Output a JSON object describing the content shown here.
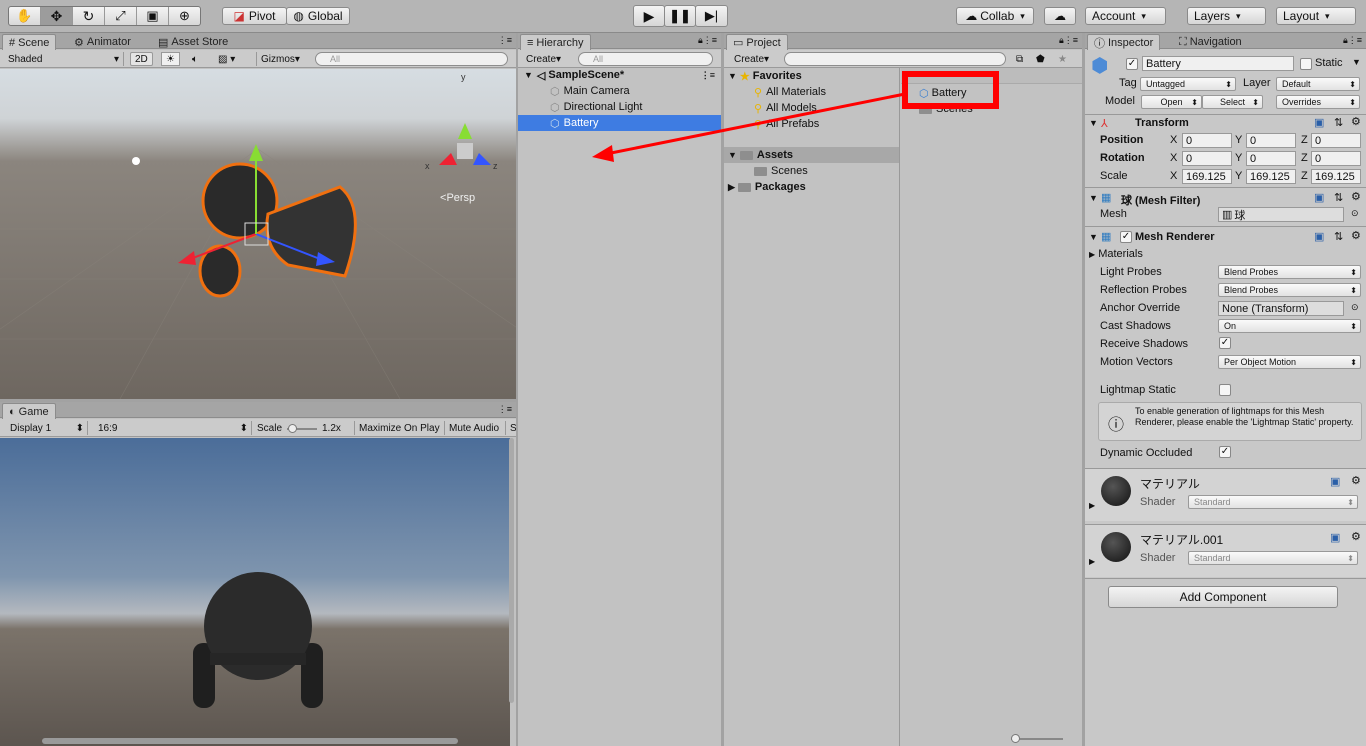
{
  "top": {
    "pivot": "Pivot",
    "global": "Global",
    "collab": "Collab",
    "account": "Account",
    "layers": "Layers",
    "layout": "Layout"
  },
  "scene": {
    "tabs": [
      "Scene",
      "Animator",
      "Asset Store"
    ],
    "shading": "Shaded",
    "mode2d": "2D",
    "gizmos": "Gizmos",
    "search_placeholder": "All",
    "persp": "Persp",
    "axis": {
      "x": "x",
      "y": "y",
      "z": "z"
    }
  },
  "game": {
    "tab": "Game",
    "display": "Display 1",
    "aspect": "16:9",
    "scale_label": "Scale",
    "scale_value": "1.2x",
    "maximize": "Maximize On Play",
    "mute": "Mute Audio",
    "stats": "S"
  },
  "hierarchy": {
    "tab": "Hierarchy",
    "create": "Create",
    "search_placeholder": "All",
    "scene": "SampleScene*",
    "items": [
      "Main Camera",
      "Directional Light",
      "Battery"
    ]
  },
  "project": {
    "tab": "Project",
    "create": "Create",
    "favorites": "Favorites",
    "fav_items": [
      "All Materials",
      "All Models",
      "All Prefabs"
    ],
    "assets": "Assets",
    "asset_children": [
      "Scenes"
    ],
    "packages": "Packages",
    "grid_items": [
      "Battery",
      "Scenes"
    ]
  },
  "inspector": {
    "tabs": [
      "Inspector",
      "Navigation"
    ],
    "object_name": "Battery",
    "static": "Static",
    "tag_label": "Tag",
    "tag": "Untagged",
    "layer_label": "Layer",
    "layer": "Default",
    "model_label": "Model",
    "open": "Open",
    "select": "Select",
    "overrides": "Overrides",
    "transform": {
      "title": "Transform",
      "rows": [
        {
          "label": "Position",
          "x": "0",
          "y": "0",
          "z": "0"
        },
        {
          "label": "Rotation",
          "x": "0",
          "y": "0",
          "z": "0"
        },
        {
          "label": "Scale",
          "x": "169.125",
          "y": "169.125",
          "z": "169.125"
        }
      ]
    },
    "mesh_filter": {
      "title": "球 (Mesh Filter)",
      "mesh_label": "Mesh",
      "mesh": "球"
    },
    "mesh_renderer": {
      "title": "Mesh Renderer",
      "materials": "Materials",
      "light_probes_label": "Light Probes",
      "light_probes": "Blend Probes",
      "reflection_probes_label": "Reflection Probes",
      "reflection_probes": "Blend Probes",
      "anchor_label": "Anchor Override",
      "anchor": "None (Transform)",
      "cast_label": "Cast Shadows",
      "cast": "On",
      "receive_label": "Receive Shadows",
      "motion_label": "Motion Vectors",
      "motion": "Per Object Motion",
      "lightmap_label": "Lightmap Static",
      "info": "To enable generation of lightmaps for this Mesh Renderer, please enable the 'Lightmap Static' property.",
      "occluded_label": "Dynamic Occluded"
    },
    "materials": [
      {
        "name": "マテリアル",
        "shader_label": "Shader",
        "shader": "Standard"
      },
      {
        "name": "マテリアル.001",
        "shader_label": "Shader",
        "shader": "Standard"
      }
    ],
    "add_component": "Add Component"
  }
}
